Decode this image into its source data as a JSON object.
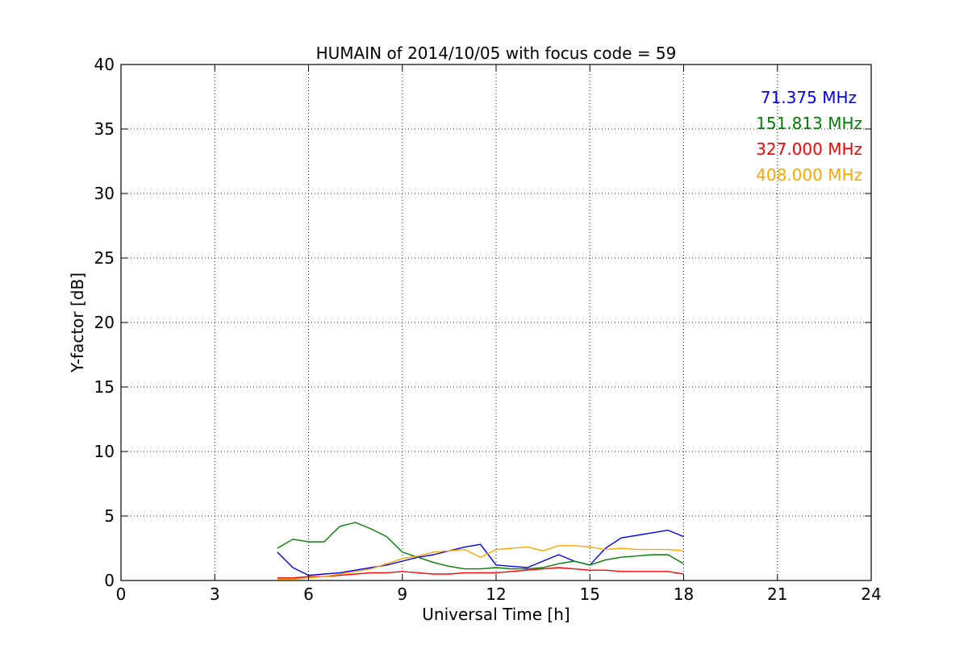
{
  "chart_data": {
    "type": "line",
    "title": "HUMAIN of 2014/10/05 with focus code = 59",
    "xlabel": "Universal Time [h]",
    "ylabel": "Y-factor [dB]",
    "xlim": [
      0,
      24
    ],
    "ylim": [
      0,
      40
    ],
    "xticks": [
      0,
      3,
      6,
      9,
      12,
      15,
      18,
      21,
      24
    ],
    "yticks": [
      0,
      5,
      10,
      15,
      20,
      25,
      30,
      35,
      40
    ],
    "xtick_labels": [
      "0",
      "3",
      "6",
      "9",
      "12",
      "15",
      "18",
      "21",
      "24"
    ],
    "ytick_labels": [
      "0",
      "5",
      "10",
      "15",
      "20",
      "25",
      "30",
      "35",
      "40"
    ],
    "grid": true,
    "legend_position": "top-right",
    "series": [
      {
        "name": "71.375 MHz",
        "color": "#0000ff",
        "x": [
          5.0,
          5.5,
          6.0,
          6.5,
          7.0,
          7.5,
          8.0,
          8.5,
          9.0,
          9.5,
          10.0,
          10.5,
          11.0,
          11.5,
          12.0,
          12.5,
          13.0,
          13.5,
          14.0,
          14.5,
          15.0,
          15.5,
          16.0,
          16.5,
          17.0,
          17.5,
          18.0
        ],
        "values": [
          2.2,
          1.0,
          0.4,
          0.5,
          0.6,
          0.8,
          1.0,
          1.2,
          1.5,
          1.8,
          2.0,
          2.3,
          2.6,
          2.8,
          1.2,
          1.1,
          1.0,
          1.5,
          2.0,
          1.5,
          1.2,
          2.5,
          3.3,
          3.5,
          3.7,
          3.9,
          3.4
        ]
      },
      {
        "name": "151.813 MHz",
        "color": "#008000",
        "x": [
          5.0,
          5.5,
          6.0,
          6.5,
          7.0,
          7.5,
          8.0,
          8.5,
          9.0,
          9.5,
          10.0,
          10.5,
          11.0,
          11.5,
          12.0,
          12.5,
          13.0,
          13.5,
          14.0,
          14.5,
          15.0,
          15.5,
          16.0,
          16.5,
          17.0,
          17.5,
          18.0
        ],
        "values": [
          2.5,
          3.2,
          3.0,
          3.0,
          4.2,
          4.5,
          4.0,
          3.4,
          2.2,
          1.8,
          1.4,
          1.1,
          0.9,
          0.9,
          1.0,
          0.9,
          0.9,
          1.0,
          1.3,
          1.5,
          1.2,
          1.6,
          1.8,
          1.9,
          2.0,
          2.0,
          1.3
        ]
      },
      {
        "name": "327.000 MHz",
        "color": "#ff0000",
        "x": [
          5.0,
          5.5,
          6.0,
          6.5,
          7.0,
          7.5,
          8.0,
          8.5,
          9.0,
          9.5,
          10.0,
          10.5,
          11.0,
          11.5,
          12.0,
          12.5,
          13.0,
          13.5,
          14.0,
          14.5,
          15.0,
          15.5,
          16.0,
          16.5,
          17.0,
          17.5,
          18.0
        ],
        "values": [
          0.2,
          0.2,
          0.3,
          0.3,
          0.4,
          0.5,
          0.6,
          0.6,
          0.7,
          0.6,
          0.5,
          0.5,
          0.6,
          0.6,
          0.6,
          0.7,
          0.8,
          0.9,
          1.0,
          0.9,
          0.8,
          0.8,
          0.7,
          0.7,
          0.7,
          0.7,
          0.5
        ]
      },
      {
        "name": "408.000 MHz",
        "color": "#ffa500",
        "x": [
          5.0,
          5.5,
          6.0,
          6.5,
          7.0,
          7.5,
          8.0,
          8.5,
          9.0,
          9.5,
          10.0,
          10.5,
          11.0,
          11.5,
          12.0,
          12.5,
          13.0,
          13.5,
          14.0,
          14.5,
          15.0,
          15.5,
          16.0,
          16.5,
          17.0,
          17.5,
          18.0
        ],
        "values": [
          0.1,
          0.1,
          0.2,
          0.3,
          0.5,
          0.7,
          0.9,
          1.3,
          1.7,
          1.9,
          2.2,
          2.3,
          2.4,
          1.8,
          2.4,
          2.5,
          2.6,
          2.3,
          2.7,
          2.7,
          2.6,
          2.4,
          2.5,
          2.4,
          2.4,
          2.4,
          2.3
        ]
      }
    ]
  }
}
